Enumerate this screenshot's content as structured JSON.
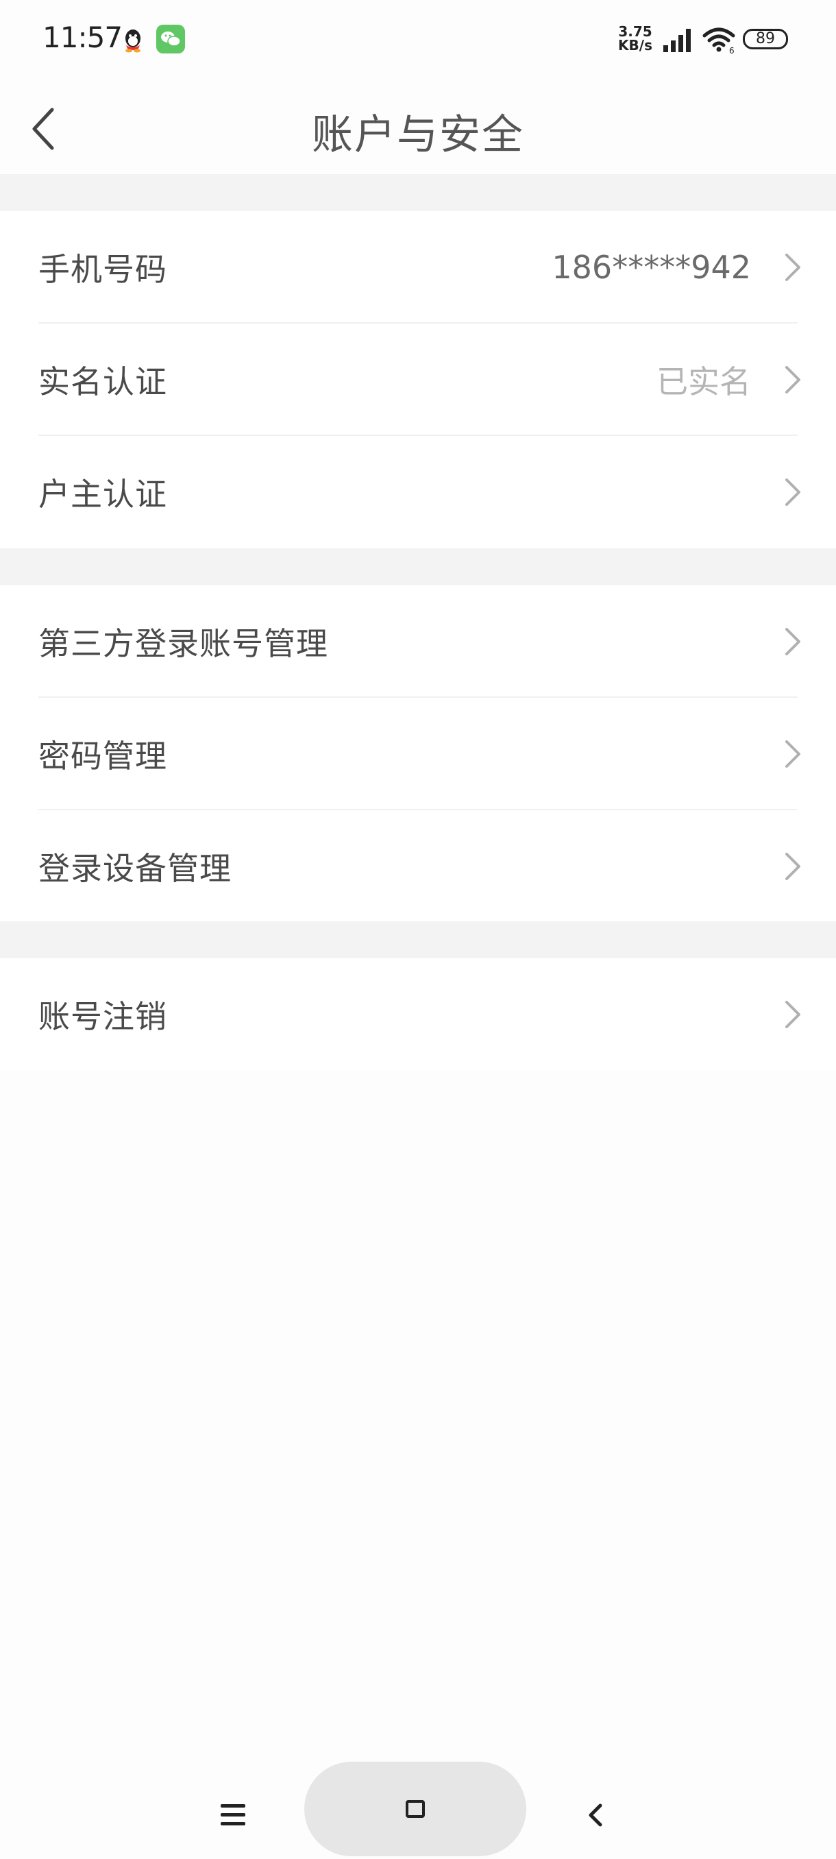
{
  "status_bar": {
    "time": "11:57",
    "net_speed_value": "3.75",
    "net_speed_unit": "KB/s",
    "battery": "89",
    "icons": [
      "qq-icon",
      "wechat-icon",
      "signal-icon",
      "wifi-icon",
      "battery-icon"
    ]
  },
  "header": {
    "title": "账户与安全",
    "back_icon": "chevron-left-icon"
  },
  "groups": [
    {
      "items": [
        {
          "label": "手机号码",
          "value": "186*****942"
        },
        {
          "label": "实名认证",
          "value": "已实名"
        },
        {
          "label": "户主认证",
          "value": ""
        }
      ]
    },
    {
      "items": [
        {
          "label": "第三方登录账号管理",
          "value": ""
        },
        {
          "label": "密码管理",
          "value": ""
        },
        {
          "label": "登录设备管理",
          "value": ""
        }
      ]
    },
    {
      "items": [
        {
          "label": "账号注销",
          "value": ""
        }
      ]
    }
  ],
  "nav_bar": {
    "icons": [
      "menu-icon",
      "home-icon",
      "back-icon"
    ]
  },
  "colors": {
    "background": "#fdfdfd",
    "section_gap": "#f3f3f3",
    "chevron": "#b0b0b0",
    "muted_text": "#b5b5b5",
    "wechat_green": "#5fc864"
  }
}
